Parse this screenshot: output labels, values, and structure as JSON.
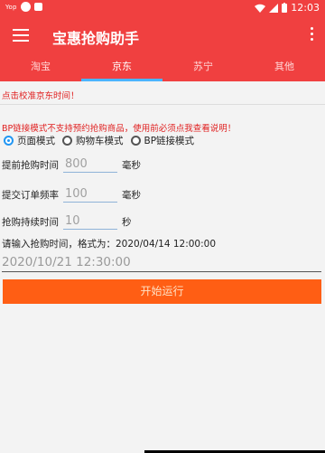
{
  "status_bar": {
    "tag": "Yop",
    "time": "12:03",
    "icons": [
      "circle-icon",
      "square-icon",
      "wifi-icon",
      "signal-icon",
      "battery-icon"
    ]
  },
  "app_bar": {
    "title": "宝惠抢购助手",
    "menu_icon": "hamburger-menu-icon",
    "more_icon": "more-vert-icon"
  },
  "tabs": [
    {
      "label": "淘宝",
      "active": false
    },
    {
      "label": "京东",
      "active": true
    },
    {
      "label": "苏宁",
      "active": false
    },
    {
      "label": "其他",
      "active": false
    }
  ],
  "notices": {
    "calibrate": "点击校准京东时间！",
    "bp_warning": "BP链接模式不支持预约抢购商品，使用前必须点我查看说明！"
  },
  "modes": [
    {
      "label": "页面模式",
      "selected": true
    },
    {
      "label": "购物车模式",
      "selected": false
    },
    {
      "label": "BP链接模式",
      "selected": false
    }
  ],
  "fields": {
    "advance": {
      "label": "提前抢购时间",
      "value": "800",
      "unit": "毫秒"
    },
    "frequency": {
      "label": "提交订单频率",
      "value": "100",
      "unit": "毫秒"
    },
    "duration": {
      "label": "抢购持续时间",
      "value": "10",
      "unit": "秒"
    }
  },
  "time_hint": "请输入抢购时间，格式为：2020/04/14 12:00:00",
  "time_input_value": "2020/10/21 12:30:00",
  "start_button": "开始运行",
  "colors": {
    "primary": "#f04040",
    "tab_indicator": "#4bb4ff",
    "warning_text": "#e02020",
    "radio_selected": "#2196f3",
    "button": "#ff5e14"
  }
}
